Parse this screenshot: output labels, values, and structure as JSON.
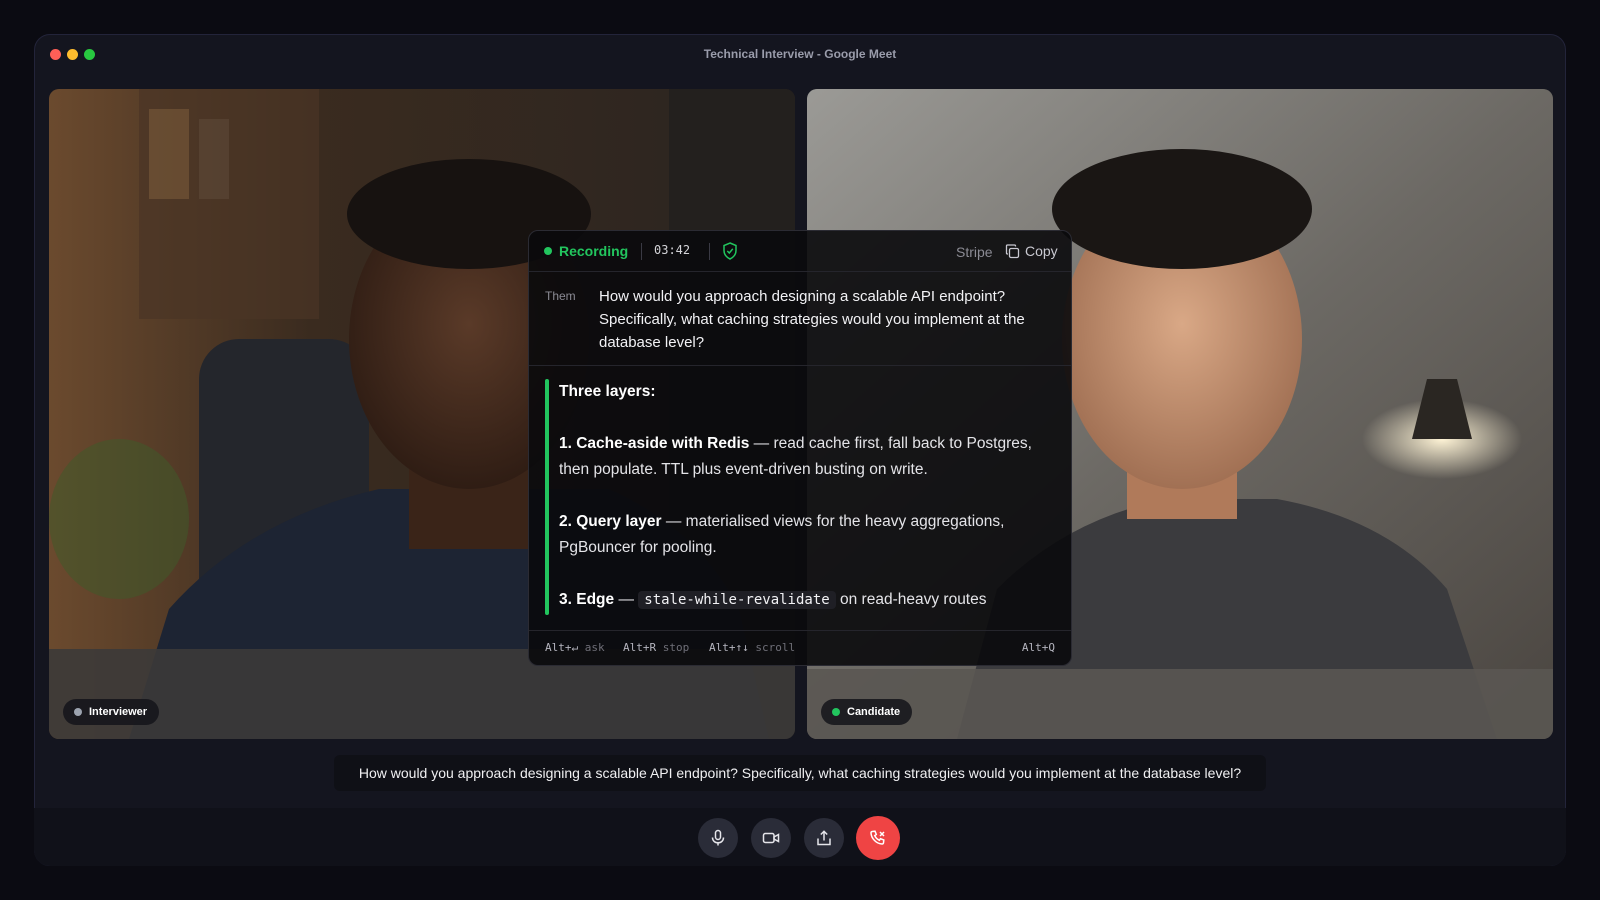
{
  "window": {
    "title": "Technical Interview - Google Meet"
  },
  "participants": {
    "left": {
      "name": "Interviewer",
      "status_color": "#9ca3af"
    },
    "right": {
      "name": "Candidate",
      "status_color": "#22c55e"
    }
  },
  "overlay": {
    "status": "Recording",
    "timer": "03:42",
    "company": "Stripe",
    "copy_label": "Copy",
    "question_speaker": "Them",
    "question": "How would you approach designing a scalable API endpoint? Specifically, what caching strategies would you implement at the database level?",
    "answer": {
      "heading": "Three layers:",
      "items": [
        {
          "title": "1. Cache-aside with Redis",
          "sep": " — ",
          "text": "read cache first, fall back to Postgres, then populate. TTL plus event-driven busting on write."
        },
        {
          "title": "2. Query layer",
          "sep": " — ",
          "text": "materialised views for the heavy aggregations, PgBouncer for pooling."
        },
        {
          "title": "3. Edge",
          "sep": " — ",
          "code": "stale-while-revalidate",
          "text": " on read-heavy routes"
        }
      ]
    },
    "shortcuts": [
      {
        "keys": "Alt+↵",
        "action": "ask"
      },
      {
        "keys": "Alt+R",
        "action": "stop"
      },
      {
        "keys": "Alt+↑↓",
        "action": "scroll"
      }
    ],
    "hide_shortcut": "Alt+Q",
    "accent": "#22c55e"
  },
  "caption": "How would you approach designing a scalable API endpoint? Specifically, what caching strategies would you implement at the database level?",
  "controls": {
    "mic": "microphone-icon",
    "camera": "camera-icon",
    "share": "share-screen-icon",
    "end": "end-call-icon",
    "end_color": "#ef4444"
  }
}
